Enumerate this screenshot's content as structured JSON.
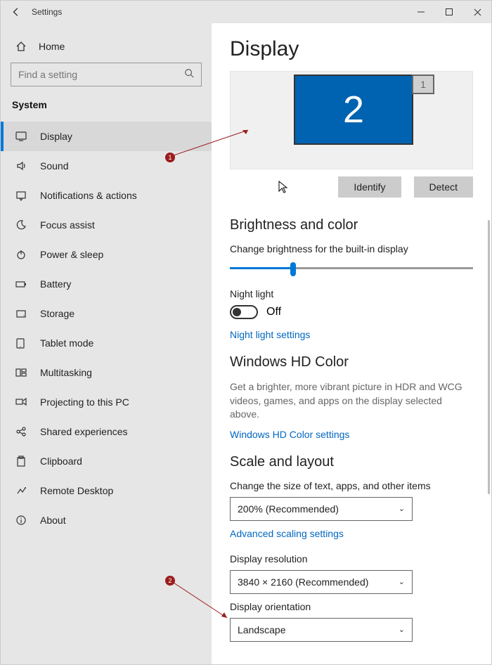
{
  "window": {
    "title": "Settings"
  },
  "sidebar": {
    "home": "Home",
    "search_placeholder": "Find a setting",
    "section": "System",
    "items": [
      {
        "label": "Display",
        "icon": "display",
        "active": true
      },
      {
        "label": "Sound",
        "icon": "sound"
      },
      {
        "label": "Notifications & actions",
        "icon": "notifications"
      },
      {
        "label": "Focus assist",
        "icon": "moon"
      },
      {
        "label": "Power & sleep",
        "icon": "power"
      },
      {
        "label": "Battery",
        "icon": "battery"
      },
      {
        "label": "Storage",
        "icon": "storage"
      },
      {
        "label": "Tablet mode",
        "icon": "tablet"
      },
      {
        "label": "Multitasking",
        "icon": "multitask"
      },
      {
        "label": "Projecting to this PC",
        "icon": "project"
      },
      {
        "label": "Shared experiences",
        "icon": "share"
      },
      {
        "label": "Clipboard",
        "icon": "clipboard"
      },
      {
        "label": "Remote Desktop",
        "icon": "remote"
      },
      {
        "label": "About",
        "icon": "about"
      }
    ]
  },
  "display": {
    "title": "Display",
    "monitors": {
      "primary": "2",
      "secondary": "1"
    },
    "identify": "Identify",
    "detect": "Detect",
    "brightness_h": "Brightness and color",
    "brightness_label": "Change brightness for the built-in display",
    "night_light_label": "Night light",
    "night_light_state": "Off",
    "night_light_link": "Night light settings",
    "hd_h": "Windows HD Color",
    "hd_desc": "Get a brighter, more vibrant picture in HDR and WCG videos, games, and apps on the display selected above.",
    "hd_link": "Windows HD Color settings",
    "scale_h": "Scale and layout",
    "scale_label": "Change the size of text, apps, and other items",
    "scale_value": "200% (Recommended)",
    "scale_link": "Advanced scaling settings",
    "resolution_label": "Display resolution",
    "resolution_value": "3840 × 2160 (Recommended)",
    "orientation_label": "Display orientation",
    "orientation_value": "Landscape"
  },
  "annotations": {
    "b1": "1",
    "b2": "2"
  }
}
